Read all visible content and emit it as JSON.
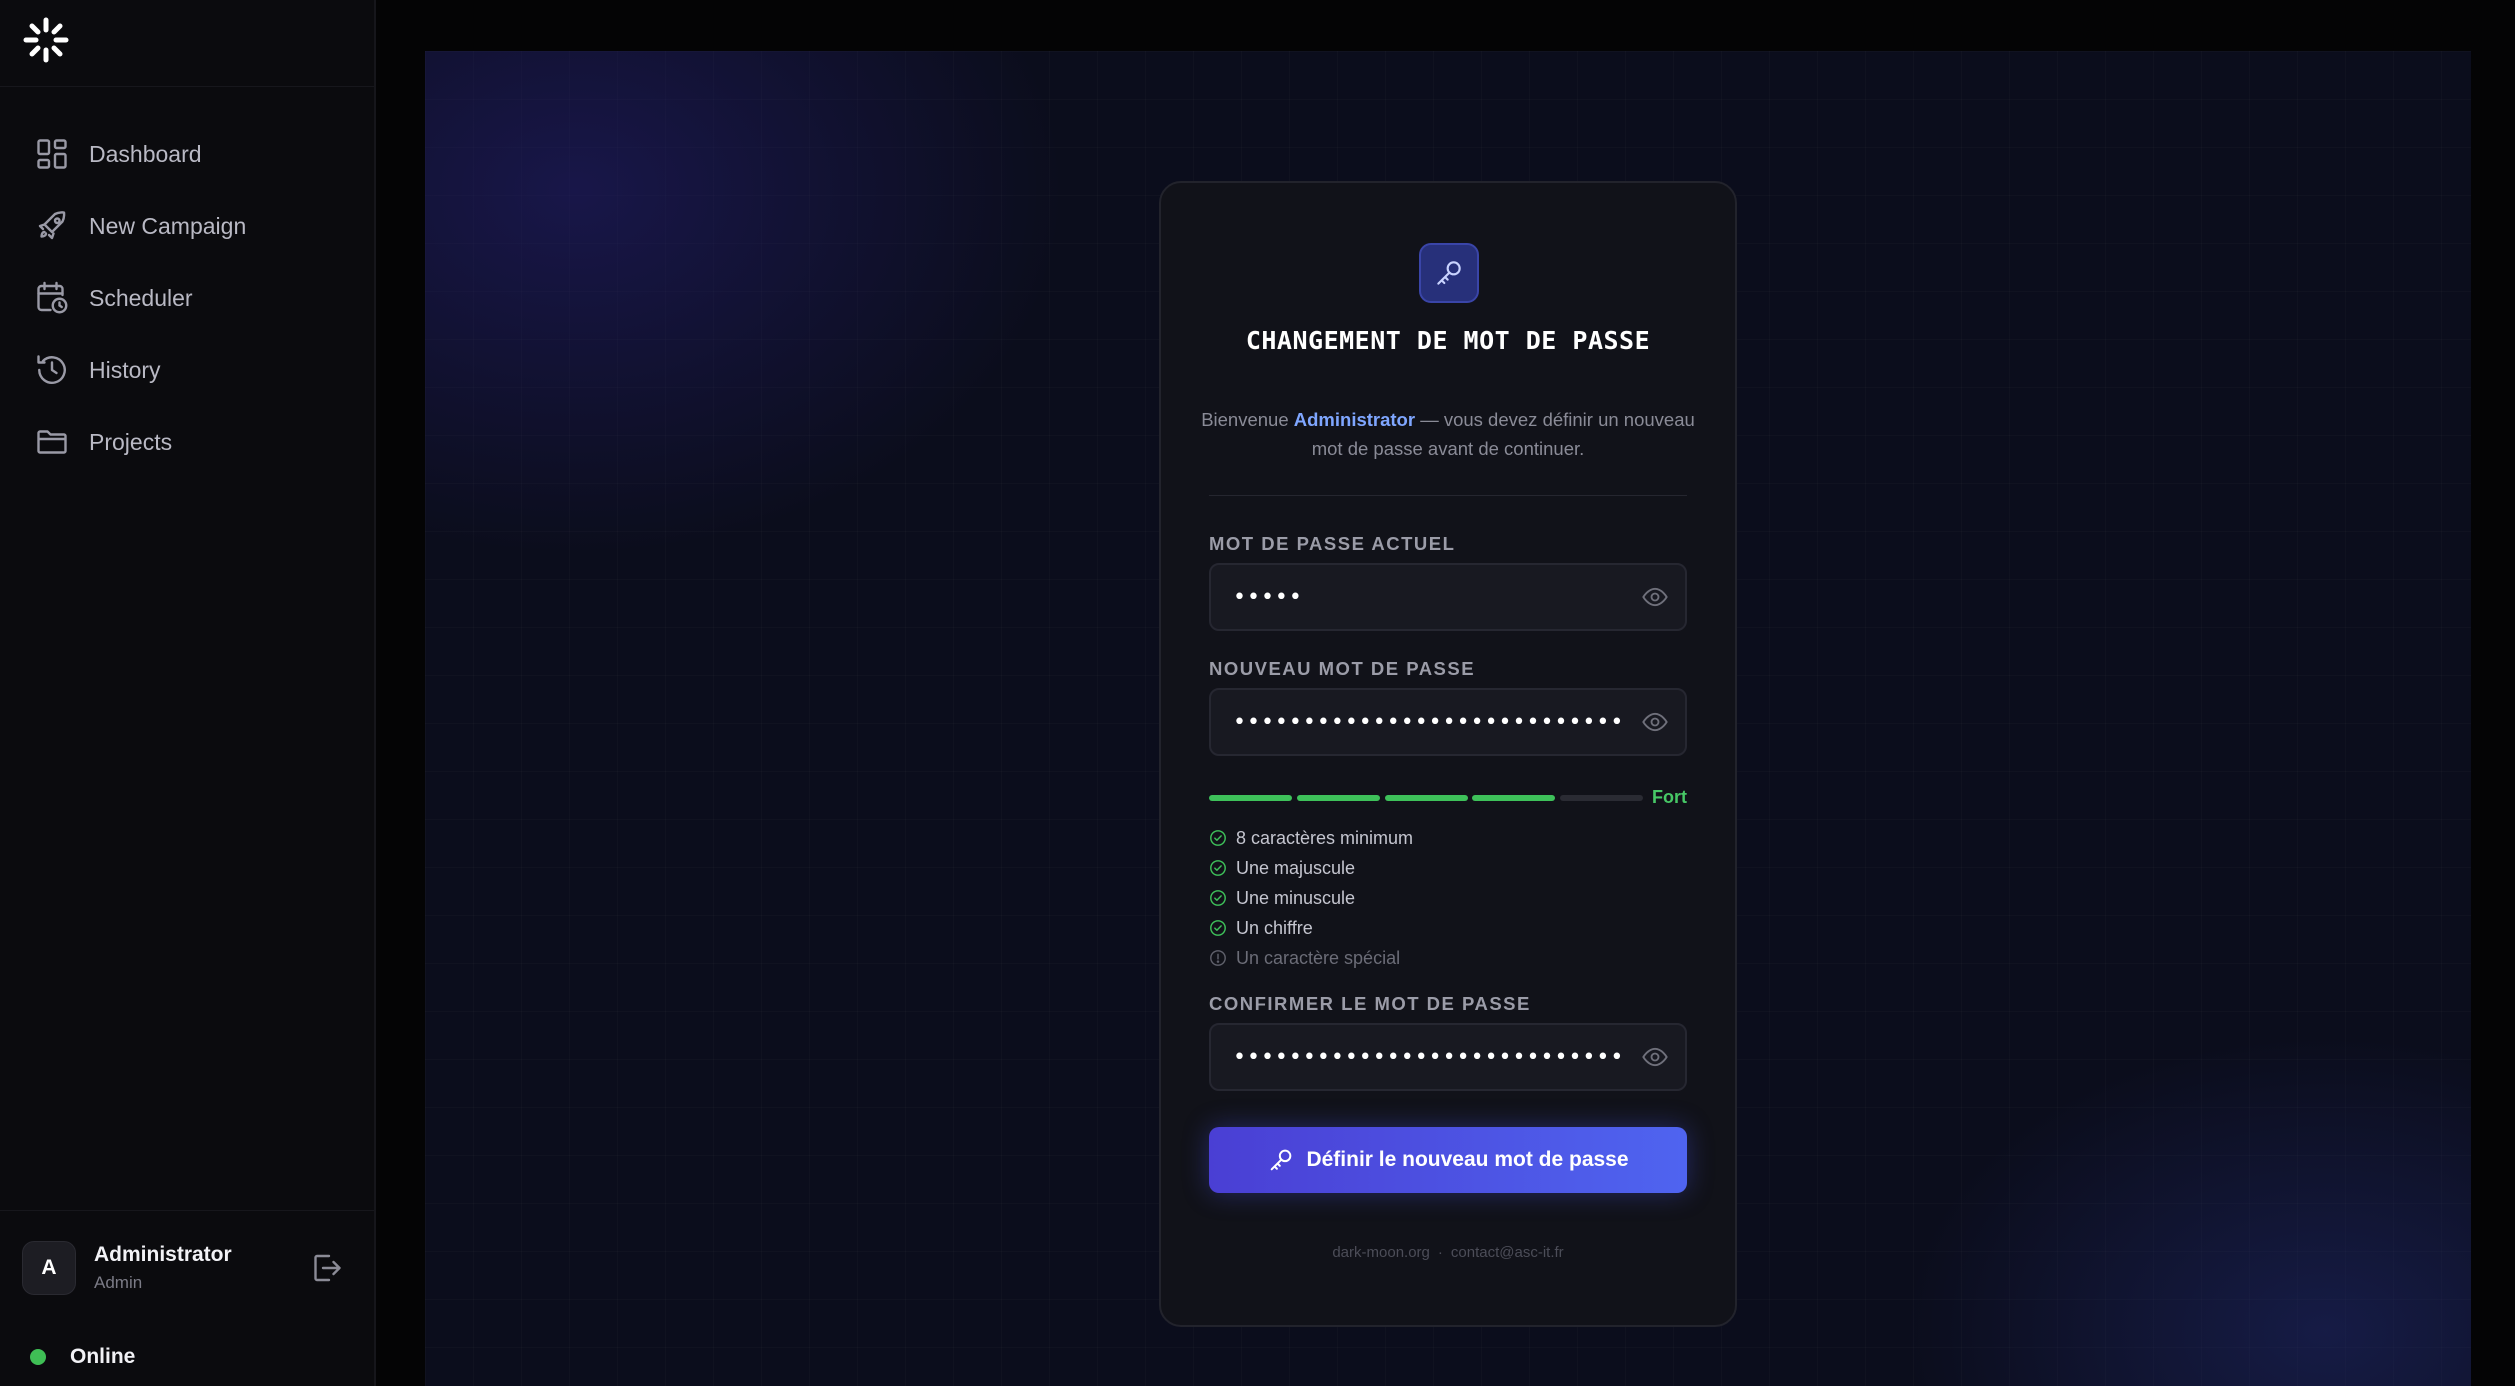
{
  "sidebar": {
    "logo_icon": "spark-burst-icon",
    "items": [
      {
        "label": "Dashboard",
        "icon": "dashboard-grid-icon"
      },
      {
        "label": "New Campaign",
        "icon": "rocket-icon"
      },
      {
        "label": "Scheduler",
        "icon": "calendar-clock-icon"
      },
      {
        "label": "History",
        "icon": "history-icon"
      },
      {
        "label": "Projects",
        "icon": "folder-icon"
      }
    ],
    "user": {
      "initial": "A",
      "name": "Administrator",
      "role": "Admin",
      "logout_icon": "logout-icon"
    },
    "status": {
      "label": "Online",
      "color": "#3fbf55"
    }
  },
  "card": {
    "icon": "key-icon",
    "title": "CHANGEMENT DE MOT DE PASSE",
    "welcome": {
      "prefix": "Bienvenue",
      "user": "Administrator",
      "suffix": "— vous devez définir un nouveau mot de passe avant de continuer."
    },
    "fields": {
      "current": {
        "label": "MOT DE PASSE ACTUEL",
        "value": "•••••"
      },
      "new": {
        "label": "NOUVEAU MOT DE PASSE",
        "value": "••••••••••••••••••••••••••••"
      },
      "confirm": {
        "label": "CONFIRMER LE MOT DE PASSE",
        "value": "••••••••••••••••••••••••••••"
      }
    },
    "strength": {
      "label": "Fort",
      "segments_filled": 4,
      "segments_total": 5,
      "color": "#3ec15a"
    },
    "requirements": [
      {
        "text": "8 caractères minimum",
        "met": true
      },
      {
        "text": "Une majuscule",
        "met": true
      },
      {
        "text": "Une minuscule",
        "met": true
      },
      {
        "text": "Un chiffre",
        "met": true
      },
      {
        "text": "Un caractère spécial",
        "met": false
      }
    ],
    "submit_label": "Définir le nouveau mot de passe",
    "footer": {
      "site": "dark-moon.org",
      "separator": "·",
      "email": "contact@asc-it.fr"
    }
  },
  "colors": {
    "accent": "#4f64f0",
    "highlight": "#7fa6ff",
    "success": "#3ec15a"
  }
}
